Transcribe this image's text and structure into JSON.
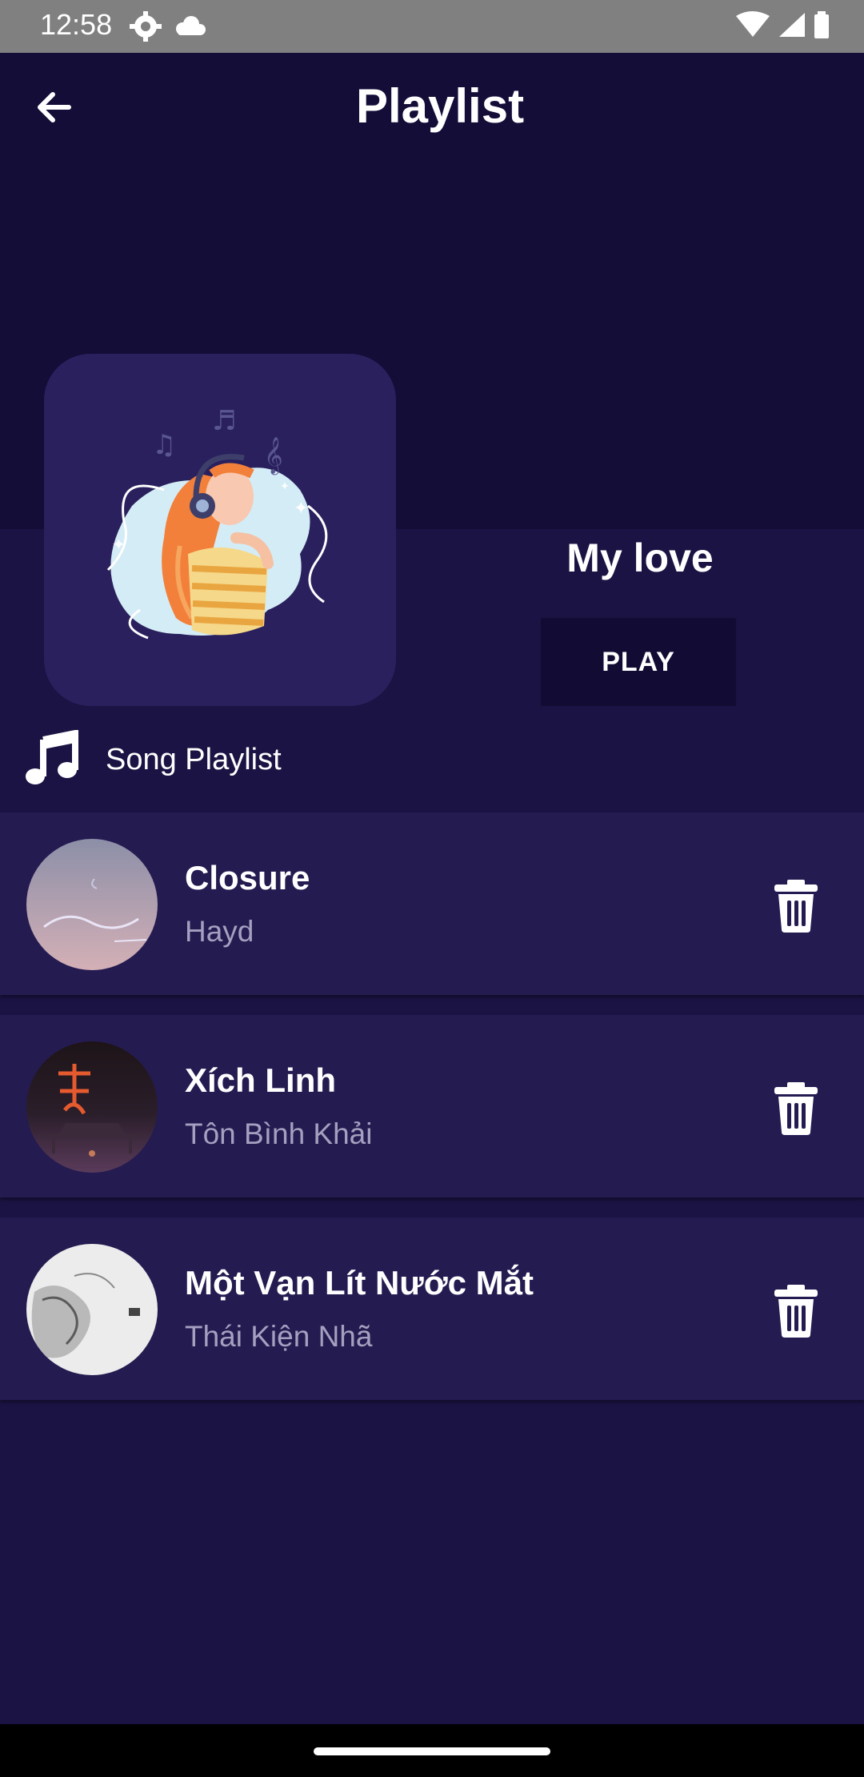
{
  "status_bar": {
    "time": "12:58",
    "icons": [
      "settings-icon",
      "cloud-icon",
      "wifi-icon",
      "signal-icon",
      "battery-icon"
    ]
  },
  "header": {
    "title": "Playlist",
    "back_icon": "arrow-left-icon"
  },
  "playlist": {
    "name": "My love",
    "play_label": "PLAY"
  },
  "section": {
    "label": "Song Playlist",
    "icon": "music-note-icon"
  },
  "songs": [
    {
      "title": "Closure",
      "artist": "Hayd"
    },
    {
      "title": "Xích Linh",
      "artist": "Tôn Bình Khải"
    },
    {
      "title": "Một Vạn Lít Nước Mắt",
      "artist": "Thái Kiện Nhã"
    }
  ],
  "colors": {
    "background": "#1b1343",
    "header_background": "#130d38",
    "card": "#241b51",
    "secondary_text": "#a5a0bf"
  }
}
